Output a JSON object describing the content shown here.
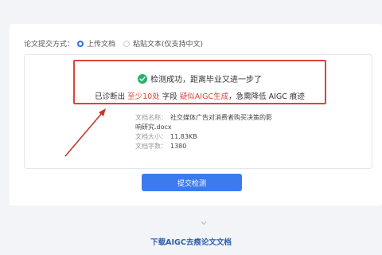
{
  "submit_mode": {
    "label": "论文提交方式：",
    "options": [
      {
        "label": "上传文档",
        "selected": true
      },
      {
        "label": "粘贴文本(仅支持中文)",
        "selected": false
      }
    ]
  },
  "result": {
    "success_text": "检测成功，距离毕业又进一步了",
    "diag_prefix": "已诊断出",
    "diag_count": "至少10处",
    "diag_middle": "字段",
    "diag_flag": "疑似AIGC生成",
    "diag_suffix": "，急需降低 AIGC 痕迹"
  },
  "file": {
    "name_label": "文档名称：",
    "name_line1": "社交媒体广告对消费者购买决策的影",
    "name_line2": "响研究.docx",
    "size_label": "文档大小：",
    "size_value": "11.83KB",
    "chars_label": "文档字数：",
    "chars_value": "1380"
  },
  "submit_button": "提交检测",
  "download_link": "下载AIGC去痕论文文档",
  "colors": {
    "accent_blue": "#3b7bf0",
    "highlight_red": "#d9443a",
    "success_green": "#27b269"
  }
}
